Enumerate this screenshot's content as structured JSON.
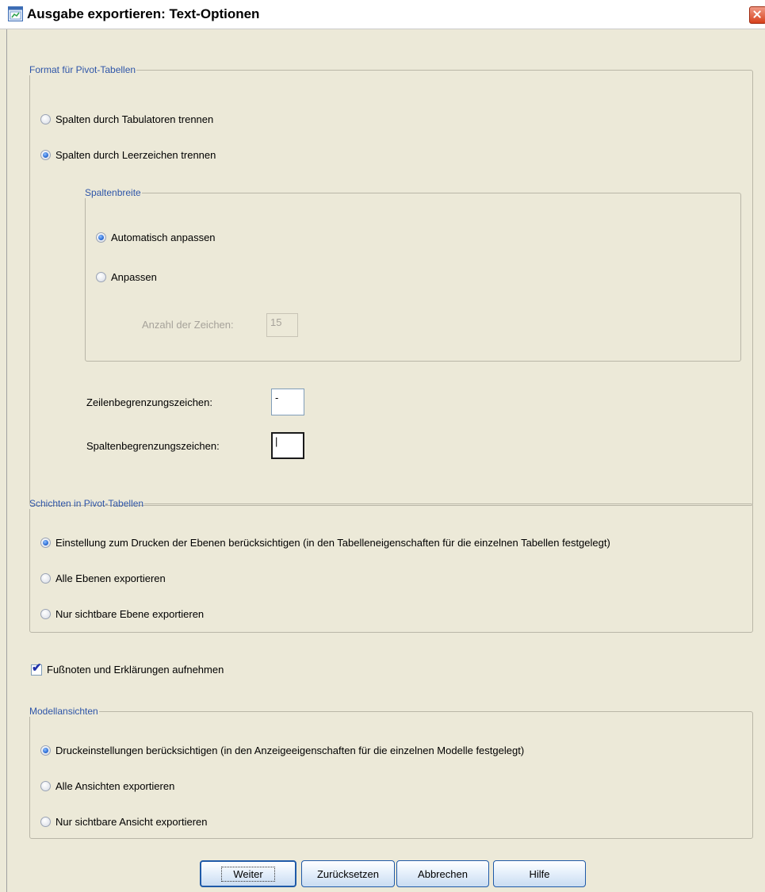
{
  "window": {
    "title": "Ausgabe exportieren: Text-Optionen",
    "icon": "spss-dialog-icon",
    "close_icon": "close-icon"
  },
  "pivot_format": {
    "legend": "Format für Pivot-Tabellen",
    "tab_label": "Spalten durch Tabulatoren trennen",
    "space_label": "Spalten durch Leerzeichen trennen",
    "selected": "space",
    "column_width": {
      "legend": "Spaltenbreite",
      "auto_label": "Automatisch anpassen",
      "custom_label": "Anpassen",
      "selected": "auto",
      "chars_label": "Anzahl der Zeichen:",
      "chars_value": "15"
    },
    "row_delim_label": "Zeilenbegrenzungszeichen:",
    "row_delim_value": "-",
    "col_delim_label": "Spaltenbegrenzungszeichen:",
    "col_delim_value": "|"
  },
  "layers": {
    "legend": "Schichten in Pivot-Tabellen",
    "options": [
      "Einstellung zum Drucken der Ebenen berücksichtigen (in den Tabelleneigenschaften für die einzelnen Tabellen festgelegt)",
      "Alle Ebenen exportieren",
      "Nur sichtbare Ebene exportieren"
    ],
    "selected": 0
  },
  "footnotes": {
    "label": "Fußnoten und Erklärungen aufnehmen",
    "checked": true
  },
  "model_views": {
    "legend": "Modellansichten",
    "options": [
      "Druckeinstellungen berücksichtigen (in den Anzeigeeigenschaften für die einzelnen Modelle festgelegt)",
      "Alle Ansichten exportieren",
      "Nur sichtbare Ansicht exportieren"
    ],
    "selected": 0
  },
  "buttons": {
    "continue": "Weiter",
    "reset": "Zurücksetzen",
    "cancel": "Abbrechen",
    "help": "Hilfe"
  },
  "colors": {
    "title_accent": "#2e55a8",
    "dialog_bg": "#ece9d8",
    "radio_selected": "#2f6fd6",
    "close_button": "#d7411c"
  }
}
